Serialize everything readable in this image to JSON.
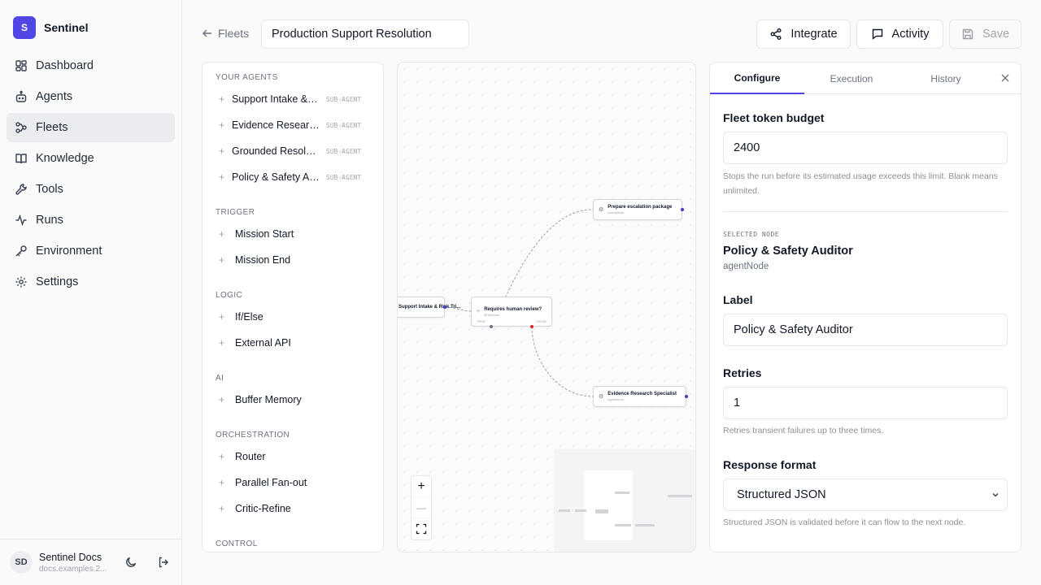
{
  "app": {
    "logo_letter": "S",
    "name": "Sentinel"
  },
  "nav": [
    {
      "label": "Dashboard",
      "icon": "dashboard-icon"
    },
    {
      "label": "Agents",
      "icon": "bot-icon"
    },
    {
      "label": "Fleets",
      "icon": "workflow-icon",
      "active": true
    },
    {
      "label": "Knowledge",
      "icon": "book-icon"
    },
    {
      "label": "Tools",
      "icon": "wrench-icon"
    },
    {
      "label": "Runs",
      "icon": "activity-icon"
    },
    {
      "label": "Environment",
      "icon": "key-icon"
    },
    {
      "label": "Settings",
      "icon": "gear-icon"
    }
  ],
  "user": {
    "initials": "SD",
    "name": "Sentinel Docs",
    "sub": "docs.examples.2..."
  },
  "header": {
    "back_label": "Fleets",
    "fleet_name": "Production Support Resolution",
    "integrate_label": "Integrate",
    "activity_label": "Activity",
    "save_label": "Save"
  },
  "palette": {
    "your_agents_title": "YOUR AGENTS",
    "agents": [
      {
        "name": "Support Intake & Risk Triage",
        "badge": "SUB-AGENT"
      },
      {
        "name": "Evidence Research Specialist",
        "badge": "SUB-AGENT"
      },
      {
        "name": "Grounded Resolution Writer",
        "badge": "SUB-AGENT"
      },
      {
        "name": "Policy & Safety Auditor",
        "badge": "SUB-AGENT"
      }
    ],
    "sections": [
      {
        "title": "TRIGGER",
        "items": [
          "Mission Start",
          "Mission End"
        ]
      },
      {
        "title": "LOGIC",
        "items": [
          "If/Else",
          "External API"
        ]
      },
      {
        "title": "AI",
        "items": [
          "Buffer Memory"
        ]
      },
      {
        "title": "ORCHESTRATION",
        "items": [
          "Router",
          "Parallel Fan-out",
          "Critic-Refine"
        ]
      },
      {
        "title": "CONTROL",
        "items": []
      }
    ]
  },
  "canvas": {
    "nodes": {
      "intake": {
        "title": "Support Intake & Risk Tri..."
      },
      "decision": {
        "title": "Requires human review?",
        "sub": "ifElseNode",
        "true_label": "TRUE",
        "false_label": "FALSE"
      },
      "escalation": {
        "title": "Prepare escalation package",
        "sub": "actionNode"
      },
      "evidence": {
        "title": "Evidence Research Specialist",
        "sub": "agentNode"
      }
    },
    "zoom_in": "+",
    "zoom_out": "—"
  },
  "panel": {
    "tabs": [
      {
        "label": "Configure",
        "active": true
      },
      {
        "label": "Execution"
      },
      {
        "label": "History"
      }
    ],
    "budget_label": "Fleet token budget",
    "budget_value": "2400",
    "budget_help": "Stops the run before its estimated usage exceeds this limit. Blank means unlimited.",
    "selected_caption": "SELECTED NODE",
    "selected_name": "Policy & Safety Auditor",
    "selected_type": "agentNode",
    "label_label": "Label",
    "label_value": "Policy & Safety Auditor",
    "retries_label": "Retries",
    "retries_value": "1",
    "retries_help": "Retries transient failures up to three times.",
    "format_label": "Response format",
    "format_value": "Structured JSON",
    "format_help": "Structured JSON is validated before it can flow to the next node."
  },
  "colors": {
    "accent": "#4f46e5",
    "true_port": "#6b7280",
    "false_port": "#dc2626",
    "port": "#4338ca"
  }
}
